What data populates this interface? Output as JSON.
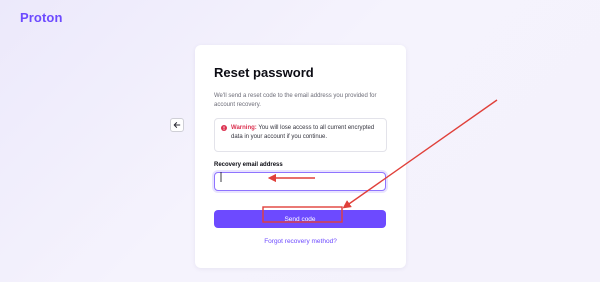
{
  "brand": {
    "name": "Proton",
    "color": "#6d4aff"
  },
  "back_button": {
    "icon": "arrow-left-icon"
  },
  "card": {
    "title": "Reset password",
    "subtitle": "We'll send a reset code to the email address you provided for account recovery.",
    "warning": {
      "icon": "alert-circle-icon",
      "label": "Warning:",
      "text": " You will lose access to all current encrypted data in your account if you continue.",
      "color": "#dc3251"
    },
    "email_field": {
      "label": "Recovery email address",
      "value": "",
      "placeholder": ""
    },
    "send_button": {
      "label": "Send code"
    },
    "forgot_link": {
      "label": "Forgot recovery method?"
    }
  },
  "annotation_color": "#e0403a"
}
